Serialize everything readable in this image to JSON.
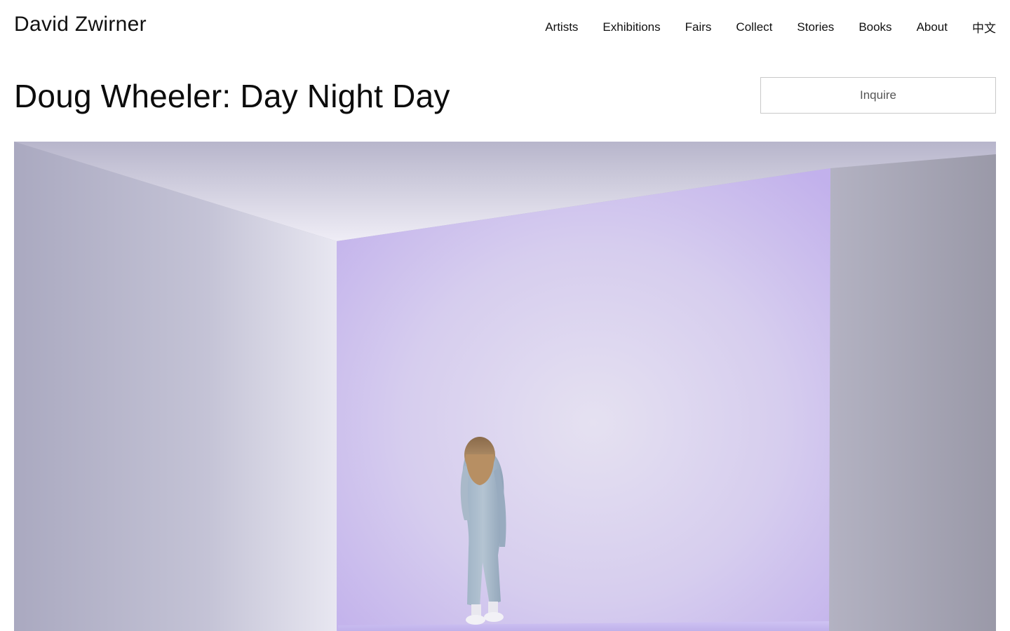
{
  "header": {
    "logo": "David Zwirner",
    "nav": [
      {
        "label": "Artists"
      },
      {
        "label": "Exhibitions"
      },
      {
        "label": "Fairs"
      },
      {
        "label": "Collect"
      },
      {
        "label": "Stories"
      },
      {
        "label": "Books"
      },
      {
        "label": "About"
      },
      {
        "label": "中文"
      }
    ]
  },
  "main": {
    "title": "Doug Wheeler: Day Night Day",
    "inquire_label": "Inquire"
  },
  "hero": {
    "icon": "installation-photo",
    "colors": {
      "lavender": "#c9baf0",
      "left_wall": "#b2b1c6",
      "right_wall": "#9d9caa"
    }
  }
}
